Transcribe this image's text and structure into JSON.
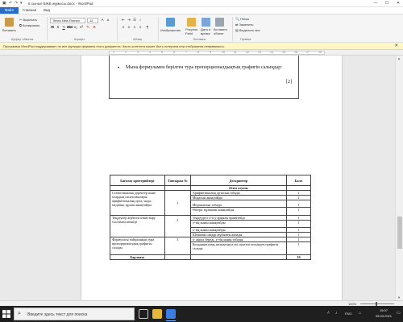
{
  "window": {
    "title": "6 сынып БЖБ жұмысы.docx - WordPad",
    "minimize": "—",
    "maximize": "☐",
    "close": "✕"
  },
  "tabs": [
    "Файл",
    "Главная",
    "Вид"
  ],
  "ribbon": {
    "paste": "Вставить",
    "cut": "Вырезать",
    "copy": "Копировать",
    "clipboard_group": "Буфер обмена",
    "font_name": "Times New Roman",
    "font_size": "12",
    "font_group": "Шрифт",
    "paragraph_group": "Абзац",
    "image": "Изображение",
    "paint": "Рисунок Paint",
    "datetime": "Дата и время",
    "object": "Вставить объект",
    "insert_group": "Вставка",
    "find": "Поиск",
    "replace": "Заменить",
    "select_all": "Выделить все",
    "edit_group": "Правка"
  },
  "notice": {
    "text": "Программа WordPad поддерживает не все функции формата этого документа. Часть контента может быть потеряна или отображена неправильно.",
    "close": "✕"
  },
  "ruler": {
    "numbers": [
      "1",
      "2",
      "3",
      "4",
      "5",
      "6",
      "7",
      "8",
      "9",
      "10",
      "11",
      "12",
      "13",
      "14",
      "15",
      "16",
      "17",
      "18"
    ]
  },
  "document": {
    "bullet": "•",
    "question": "Мына формуламен берілген тура пропорционалдықтың графигін салыңдар:",
    "points": "[2]",
    "table": {
      "headers": [
        "Бағалау критерийлері",
        "Тапсырма №",
        "Дескриптор",
        "Балл"
      ],
      "subheader": "Білім алушы",
      "rows": [
        {
          "criterion": "Статистикалық деректер және олардың сипаттамалары: арифметикалық орта, мода, медиана, құлаш анықтайды",
          "task": "1",
          "descriptors": [
            "Арифметикалық ортасын табады",
            "Модасын анықтайды",
            "Медианасын табады",
            "Өзгеріс құлашын анықтайды."
          ],
          "scores": [
            "1",
            "1",
            "1",
            "1"
          ]
        },
        {
          "criterion": "Теңдеулер жүйесін алмастыру тәсілімен шешеді",
          "task": "2",
          "descriptors": [
            "Теңдеудегі x-ті у арқылы өрнектейді",
            "у-тің мәнін анықтайды",
            "х-тің мәнін анықтайды",
            "Шешімін сандар жұбымен жазады"
          ],
          "scores": [
            "1",
            "1",
            "1",
            "1"
          ]
        },
        {
          "criterion": "Формуласы пайдаланып,тура пропорционалдық графигін салады",
          "task": "3",
          "descriptors": [
            "х- ақпал береді, у-тің мәнін табады",
            "Координаталық жазықтықта екі нүктені кескіндеп,графигін салады"
          ],
          "scores": [
            "1",
            "1"
          ]
        }
      ],
      "total_label": "Барлығы",
      "total_value": "10"
    }
  },
  "statusbar": {
    "zoom": "100%"
  },
  "taskbar": {
    "search_placeholder": "Введите здесь текст для поиска",
    "lang": "ENG",
    "time": "15:07",
    "date": "05.03.2021"
  },
  "colors": {
    "accent": "#2b6cc4",
    "notice_bg": "#fff6c6",
    "taskbar": "#1f1f1f"
  }
}
